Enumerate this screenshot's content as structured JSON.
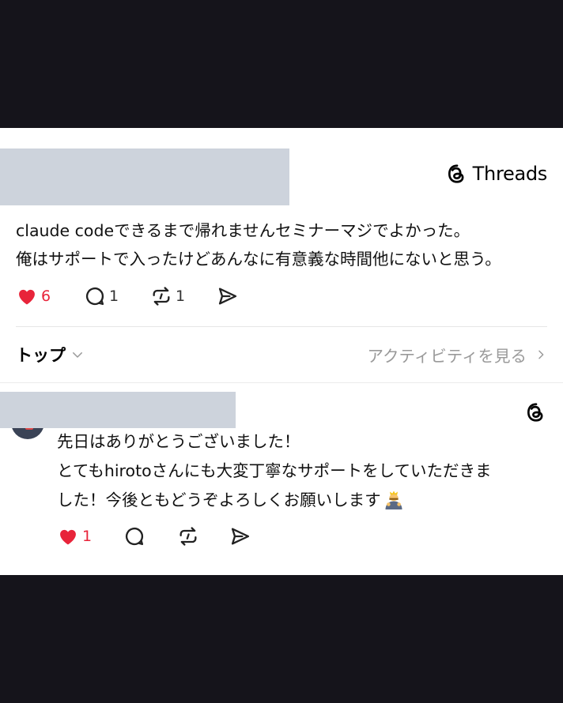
{
  "brand": {
    "name": "Threads"
  },
  "post": {
    "lines": [
      "claude codeできるまで帰れませんセミナーマジでよかった。",
      "俺はサポートで入ったけどあんなに有意義な時間他にないと思う。"
    ],
    "likes": "6",
    "replies": "1",
    "reposts": "1"
  },
  "tabs": {
    "top_label": "トップ",
    "activity_label": "アクティビティを見る"
  },
  "reply": {
    "lines": [
      "先日はありがとうございました！",
      "とてもhirotoさんにも大変丁寧なサポートをしていただきま",
      "した！今後ともどうぞよろしくお願いします"
    ],
    "likes": "1"
  },
  "colors": {
    "background": "#15141b",
    "card": "#ffffff",
    "like": "#e8243a",
    "muted": "#9a9a9a",
    "redaction": "#cdd3dc"
  },
  "icons": [
    "threads-logo-icon",
    "heart-icon",
    "comment-icon",
    "repost-icon",
    "share-icon",
    "chevron-down-icon",
    "chevron-right-icon",
    "bowing-person-emoji"
  ]
}
